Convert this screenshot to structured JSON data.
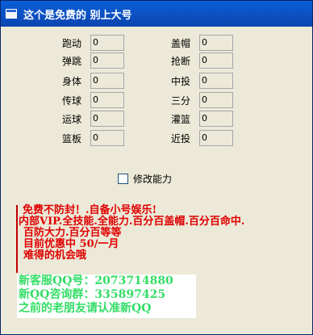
{
  "window": {
    "title": "这个是免费的 别上大号"
  },
  "stats": [
    {
      "label": "跑动",
      "value": "0"
    },
    {
      "label": "盖帽",
      "value": "0"
    },
    {
      "label": "弹跳",
      "value": "0"
    },
    {
      "label": "抢断",
      "value": "0"
    },
    {
      "label": "身体",
      "value": "0"
    },
    {
      "label": "中投",
      "value": "0"
    },
    {
      "label": "传球",
      "value": "0"
    },
    {
      "label": "三分",
      "value": "0"
    },
    {
      "label": "运球",
      "value": "0"
    },
    {
      "label": "灌篮",
      "value": "0"
    },
    {
      "label": "篮板",
      "value": "0"
    },
    {
      "label": "近投",
      "value": "0"
    }
  ],
  "modify": {
    "label": "修改能力",
    "checked": false
  },
  "notice": {
    "lines": [
      "免费不防封！.自备小号娱乐!",
      "内部VIP.全技能.全能力.百分百盖帽.百分百命中.",
      "百防大力.百分百等等",
      "目前优惠中  50/一月",
      "难得的机会哦"
    ]
  },
  "contact": {
    "lines": [
      "新客服QQ号：2073714880",
      "新QQ咨询群：335897425",
      "之前的老朋友请认准新QQ"
    ]
  }
}
